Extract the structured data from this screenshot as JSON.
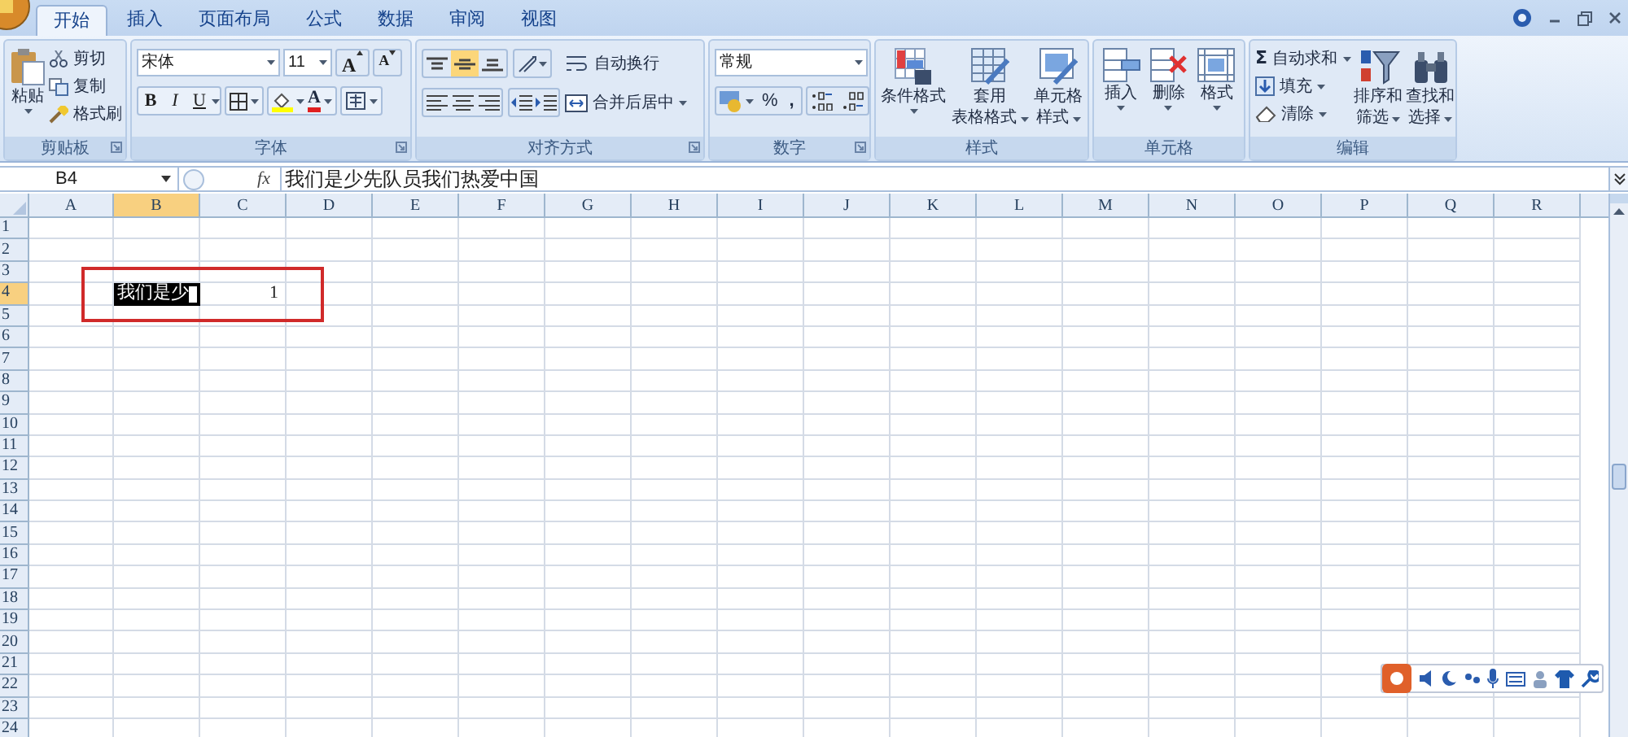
{
  "tabs": [
    {
      "label": "开始",
      "selected": true
    },
    {
      "label": "插入",
      "selected": false
    },
    {
      "label": "页面布局",
      "selected": false
    },
    {
      "label": "公式",
      "selected": false
    },
    {
      "label": "数据",
      "selected": false
    },
    {
      "label": "审阅",
      "selected": false
    },
    {
      "label": "视图",
      "selected": false
    }
  ],
  "ribbon": [
    {
      "kind": "clipboard",
      "label": "剪贴板",
      "large": {
        "lines": [
          "粘贴"
        ]
      },
      "small": [
        "剪切",
        "复制",
        "格式刷"
      ]
    },
    {
      "kind": "font",
      "label": "字体",
      "font_name": "宋体",
      "font_size": "11",
      "grow": "A",
      "shrink": "A",
      "styles": [
        "B",
        "I",
        "U"
      ],
      "font_color": "A"
    },
    {
      "kind": "alignment",
      "label": "对齐方式",
      "vertical": [
        {
          "selected": false
        },
        {
          "selected": true
        },
        {
          "selected": false
        }
      ],
      "wrap": "自动换行",
      "merge": "合并后居中"
    },
    {
      "kind": "number",
      "label": "数字",
      "format": "常规",
      "percent": "%",
      "comma": ","
    },
    {
      "kind": "styles",
      "label": "样式",
      "large": [
        {
          "lines": [
            "条件格式"
          ]
        },
        {
          "lines": [
            "套用",
            "表格格式"
          ]
        },
        {
          "lines": [
            "单元格",
            "样式"
          ]
        }
      ]
    },
    {
      "kind": "cells",
      "label": "单元格",
      "large": [
        {
          "lines": [
            "插入"
          ]
        },
        {
          "lines": [
            "删除"
          ]
        },
        {
          "lines": [
            "格式"
          ]
        }
      ]
    },
    {
      "kind": "editing",
      "label": "编辑",
      "sum_symbol": "Σ",
      "small": [
        "自动求和",
        "填充",
        "清除"
      ],
      "large": [
        {
          "lines": [
            "排序和",
            "筛选"
          ]
        },
        {
          "lines": [
            "查找和",
            "选择"
          ]
        }
      ]
    }
  ],
  "formula_bar": {
    "name_box": "B4",
    "fx": "fx",
    "value": "我们是少先队员我们热爱中国"
  },
  "columns": [
    {
      "label": "A",
      "selected": false
    },
    {
      "label": "B",
      "selected": true
    },
    {
      "label": "C",
      "selected": false
    },
    {
      "label": "D",
      "selected": false
    },
    {
      "label": "E",
      "selected": false
    },
    {
      "label": "F",
      "selected": false
    },
    {
      "label": "G",
      "selected": false
    },
    {
      "label": "H",
      "selected": false
    },
    {
      "label": "I",
      "selected": false
    },
    {
      "label": "J",
      "selected": false
    },
    {
      "label": "K",
      "selected": false
    },
    {
      "label": "L",
      "selected": false
    },
    {
      "label": "M",
      "selected": false
    },
    {
      "label": "N",
      "selected": false
    },
    {
      "label": "O",
      "selected": false
    },
    {
      "label": "P",
      "selected": false
    },
    {
      "label": "Q",
      "selected": false
    },
    {
      "label": "R",
      "selected": false
    }
  ],
  "rows": [
    {
      "label": "1",
      "selected": false
    },
    {
      "label": "2",
      "selected": false
    },
    {
      "label": "3",
      "selected": false
    },
    {
      "label": "4",
      "selected": true,
      "cells": [
        {
          "kind": "blank"
        },
        {
          "kind": "editing",
          "text": "我们是少"
        },
        {
          "kind": "number",
          "text": "1"
        }
      ]
    },
    {
      "label": "5",
      "selected": false
    },
    {
      "label": "6",
      "selected": false
    },
    {
      "label": "7",
      "selected": false
    },
    {
      "label": "8",
      "selected": false
    },
    {
      "label": "9",
      "selected": false
    },
    {
      "label": "10",
      "selected": false
    },
    {
      "label": "11",
      "selected": false
    },
    {
      "label": "12",
      "selected": false
    },
    {
      "label": "13",
      "selected": false
    },
    {
      "label": "14",
      "selected": false
    },
    {
      "label": "15",
      "selected": false
    },
    {
      "label": "16",
      "selected": false
    },
    {
      "label": "17",
      "selected": false
    },
    {
      "label": "18",
      "selected": false
    },
    {
      "label": "19",
      "selected": false
    },
    {
      "label": "20",
      "selected": false
    },
    {
      "label": "21",
      "selected": false
    },
    {
      "label": "22",
      "selected": false
    },
    {
      "label": "23",
      "selected": false
    },
    {
      "label": "24",
      "selected": false
    }
  ],
  "highlight_frame": true,
  "ime_toolbar": true
}
